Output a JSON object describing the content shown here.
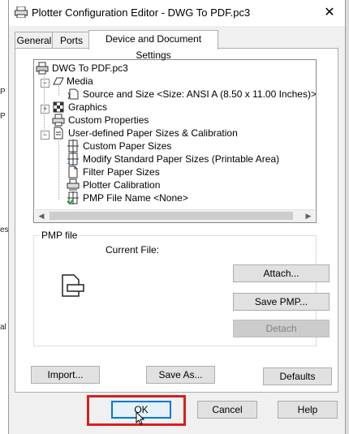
{
  "window": {
    "title": "Plotter Configuration Editor - DWG To PDF.pc3",
    "close_glyph": "✕"
  },
  "tabs": [
    {
      "label": "General"
    },
    {
      "label": "Ports"
    },
    {
      "label": "Device and Document Settings"
    }
  ],
  "tree": {
    "items": [
      {
        "label": "DWG To PDF.pc3",
        "icon": "plotter-icon"
      },
      {
        "label": "Media",
        "icon": "media-icon"
      },
      {
        "label": "Source and Size <Size: ANSI A (8.50 x 11.00 Inches)>",
        "icon": "paper-source-icon"
      },
      {
        "label": "Graphics",
        "icon": "graphics-icon"
      },
      {
        "label": "Custom Properties",
        "icon": "custom-properties-icon"
      },
      {
        "label": "User-defined Paper Sizes & Calibration",
        "icon": "paper-sizes-icon"
      },
      {
        "label": "Custom Paper Sizes",
        "icon": "custom-paper-icon"
      },
      {
        "label": "Modify Standard Paper Sizes (Printable Area)",
        "icon": "modify-paper-icon"
      },
      {
        "label": "Filter Paper Sizes",
        "icon": "filter-paper-icon"
      },
      {
        "label": "Plotter Calibration",
        "icon": "calibration-icon"
      },
      {
        "label": "PMP File Name <None>",
        "icon": "pmp-file-icon"
      }
    ],
    "expanders": [
      "−",
      "−",
      "+",
      "−"
    ]
  },
  "scrollbar": {
    "left_arrow": "◀",
    "right_arrow": "▶"
  },
  "pmp": {
    "group_label": "PMP file",
    "current_file_label": "Current File:",
    "attach_label": "Attach...",
    "save_pmp_label": "Save PMP...",
    "detach_label": "Detach"
  },
  "actions": {
    "import_label": "Import...",
    "save_as_label": "Save As...",
    "defaults_label": "Defaults"
  },
  "footer": {
    "ok_label": "OK",
    "cancel_label": "Cancel",
    "help_label": "Help"
  },
  "background_markers": [
    "P",
    "P",
    "es",
    "al"
  ],
  "colors": {
    "highlight": "#d42020",
    "focus": "#0078d7"
  }
}
